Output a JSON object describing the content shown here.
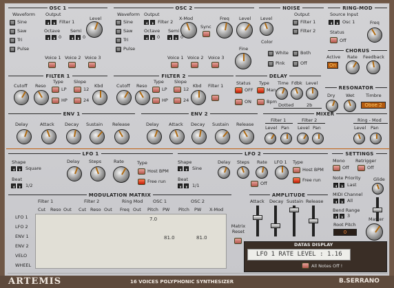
{
  "osc1": {
    "title": "OSC 1",
    "waveform": "Waveform",
    "output": "Output",
    "filter": "Filter 1",
    "level": "Level",
    "sine": "Sine",
    "saw": "Saw",
    "tri": "Tri",
    "pulse": "Pulse",
    "octave": "Octave",
    "semi": "Semi",
    "oct_val": "0",
    "semi_val": "0",
    "voice1": "Voice 1",
    "voice2": "Voice 2",
    "voice3": "Voice 3"
  },
  "osc2": {
    "title": "OSC 2",
    "waveform": "Waveform",
    "output": "Output",
    "filter": "Filter 2",
    "xmod": "X-Mod",
    "sync": "Sync",
    "freq": "Freq",
    "level": "Level",
    "sine": "Sine",
    "saw": "Saw",
    "tri": "Tri",
    "pulse": "Pulse",
    "octave": "Octave",
    "semi": "Semi",
    "oct_val": "0",
    "semi_val": "0",
    "voice1": "Voice 1",
    "voice2": "Voice 2",
    "voice3": "Voice 3",
    "fine": "Fine"
  },
  "noise": {
    "title": "NOISE",
    "level": "Level",
    "output": "Output",
    "filter1": "Filter 1",
    "filter2": "Filter 2",
    "color": "Color",
    "white": "White",
    "both": "Both",
    "pink": "Pink",
    "off": "Off"
  },
  "ringmod": {
    "title": "RING-MOD",
    "source": "Source Input",
    "osc": "Osc 1",
    "freq": "Freq",
    "status": "Status",
    "off": "Off"
  },
  "chorus": {
    "title": "CHORUS",
    "active": "Active",
    "rate": "Rate",
    "feedback": "Feedback",
    "on": "On"
  },
  "filter1": {
    "title": "FILTER 1",
    "cutoff": "Cutoff",
    "reso": "Reso",
    "type": "Type",
    "slope": "Slope",
    "kbd": "Kbd",
    "lp": "LP",
    "hp": "HP",
    "s12": "12",
    "s24": "24"
  },
  "filter2": {
    "title": "FILTER 2",
    "cutoff": "Cutoff",
    "reso": "Reso",
    "type": "Type",
    "slope": "Slope",
    "kbd": "Kbd",
    "filter1": "Filter 1",
    "lp": "LP",
    "hp": "HP",
    "s12": "12",
    "s24": "24"
  },
  "delay": {
    "title": "DELAY",
    "status": "Status",
    "off": "OFF",
    "on": "ON",
    "type": "Type",
    "man": "Man",
    "bpm": "Bpm",
    "time": "Time",
    "fdbk": "Fdbk",
    "level": "Level",
    "dotted": "Dotted",
    "val": "2b"
  },
  "resonator": {
    "title": "RESONATOR",
    "dry": "Dry",
    "wet": "Wet",
    "timbre": "Timbre",
    "timbre_val": "Oboe 2"
  },
  "mixer": {
    "title": "MIXER",
    "filter1": "Filter 1",
    "filter2": "Filter 2",
    "ringmod": "Ring - Mod",
    "level": "Level",
    "pan": "Pan"
  },
  "env1": {
    "title": "ENV 1",
    "delay": "Delay",
    "attack": "Attack",
    "decay": "Decay",
    "sustain": "Sustain",
    "release": "Release"
  },
  "env2": {
    "title": "ENV 2",
    "delay": "Delay",
    "attack": "Attack",
    "decay": "Decay",
    "sustain": "Sustain",
    "release": "Release"
  },
  "lfo1": {
    "title": "LFO 1",
    "shape": "Shape",
    "shape_val": "Square",
    "delay": "Delay",
    "steps": "Steps",
    "rate": "Rate",
    "type": "Type",
    "host": "Host BPM",
    "free": "Free run",
    "beat": "Beat",
    "beat_val": "1/2"
  },
  "lfo2": {
    "title": "LFO 2",
    "shape": "Shape",
    "shape_val": "Sine",
    "delay": "Delay",
    "steps": "Steps",
    "rate": "Rate",
    "lfo1": "LFO 1",
    "type": "Type",
    "host": "Host BPM",
    "free": "Free run",
    "beat": "Beat",
    "beat_val": "1/1",
    "off": "Off"
  },
  "settings": {
    "title": "SETTINGS",
    "mono": "Mono",
    "retrigger": "Retrigger",
    "off": "Off",
    "off2": "Off",
    "priority": "Note Priority",
    "last": "Last",
    "glide": "Glide",
    "midi": "MIDI Channel",
    "all": "All",
    "bend": "Bend Range",
    "bend_val": "3",
    "root": "Root Pitch",
    "root_val": "0",
    "master": "Master"
  },
  "matrix": {
    "title": "MODULATION MATRIX",
    "groups": [
      "Filter 1",
      "Filter 2",
      "Ring Mod",
      "OSC 1",
      "OSC 2"
    ],
    "cols": [
      "Cut",
      "Reso",
      "Out",
      "Cut",
      "Reso",
      "Out",
      "Freq",
      "Out",
      "Pitch",
      "PW",
      "Pitch",
      "PW",
      "X-Mod"
    ],
    "rows": [
      "LFO 1",
      "LFO 2",
      "ENV 1",
      "ENV 2",
      "VELO",
      "WHEEL"
    ],
    "v1": "7.0",
    "v2": "81.0",
    "v3": "81.0",
    "reset": "Matrix Reset"
  },
  "amplitude": {
    "title": "AMPLITUDE",
    "attack": "Attack",
    "decay": "Decay",
    "sustain": "Sustain",
    "release": "Release"
  },
  "datas": {
    "title": "DATAS DISPLAY",
    "text": "LFO 1 RATE LEVEL : 1.16",
    "all_notes": "All Notes Off !"
  },
  "footer": {
    "brand": "ARTEMIS",
    "subtitle": "16 VOICES POLYPHONIC SYNTHESIZER",
    "author": "B.SERRANO"
  }
}
